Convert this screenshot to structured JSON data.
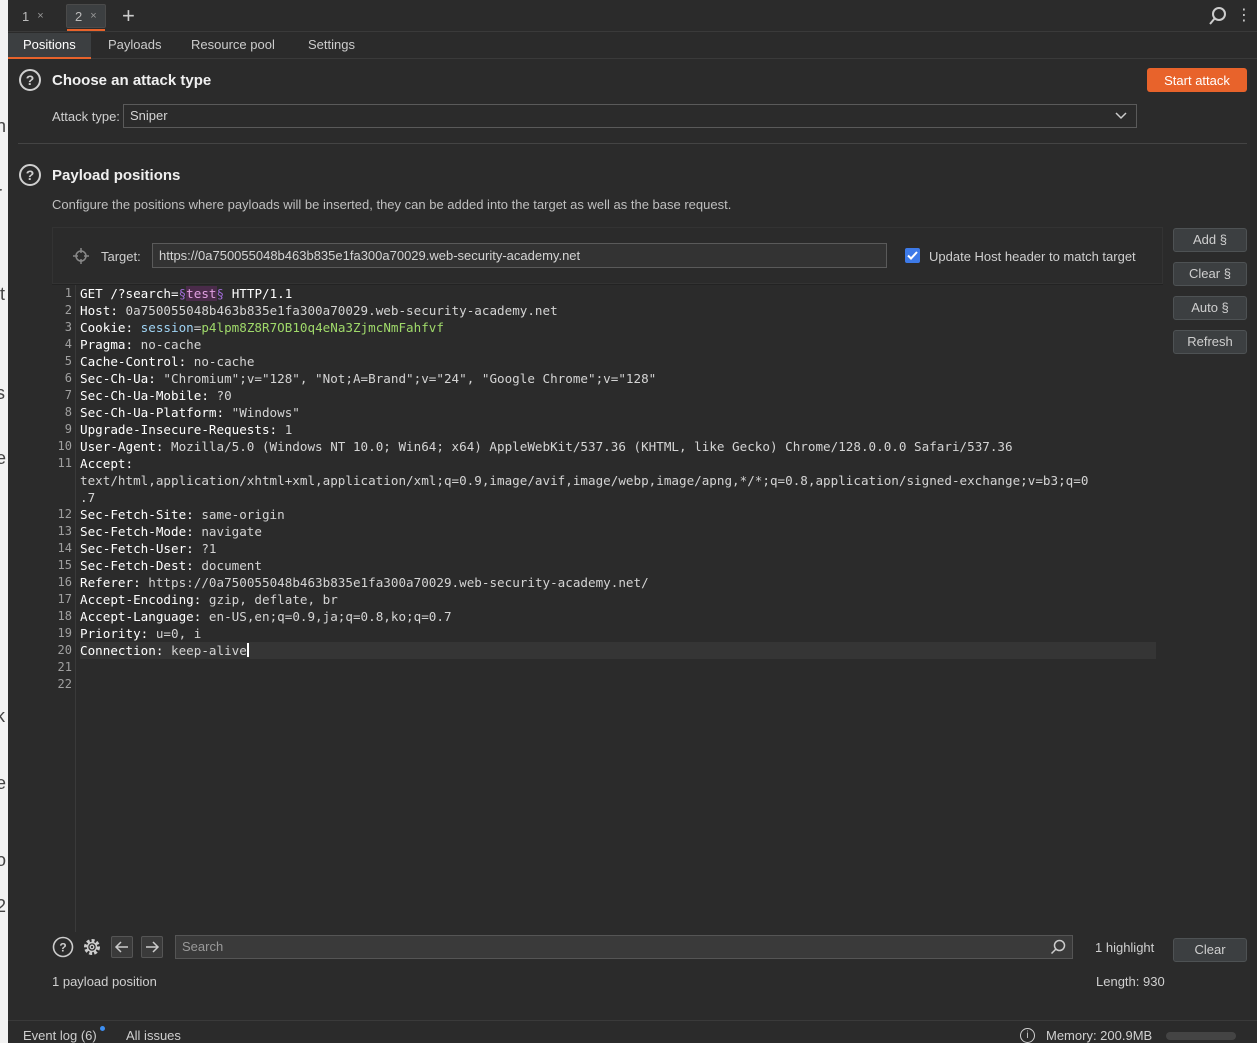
{
  "window_tabs": [
    {
      "label": "1",
      "close": "×"
    },
    {
      "label": "2",
      "close": "×"
    }
  ],
  "new_tab_label": "+",
  "sub_tabs": [
    "Positions",
    "Payloads",
    "Resource pool",
    "Settings"
  ],
  "active_sub_tab": "Positions",
  "attack_section": {
    "help": "?",
    "title": "Choose an attack type",
    "start_button": "Start attack",
    "attack_type_label": "Attack type:",
    "attack_type_value": "Sniper"
  },
  "positions_section": {
    "help": "?",
    "title": "Payload positions",
    "description": "Configure the positions where payloads will be inserted, they can be added into the target as well as the base request.",
    "target_label": "Target:",
    "target_value": "https://0a750055048b463b835e1fa300a70029.web-security-academy.net",
    "update_host_checked": true,
    "update_host_label": "Update Host header to match target"
  },
  "side_buttons": {
    "add": "Add §",
    "clear": "Clear §",
    "auto": "Auto §",
    "refresh": "Refresh"
  },
  "request": {
    "line1": {
      "prefix": "GET /?search=",
      "open": "§",
      "payload": "test",
      "close": "§",
      "suffix": " HTTP/1.1"
    },
    "headers": [
      {
        "n": "2",
        "k": "Host:",
        "v": " 0a750055048b463b835e1fa300a70029.web-security-academy.net"
      },
      {
        "n": "4",
        "k": "Pragma:",
        "v": " no-cache"
      },
      {
        "n": "5",
        "k": "Cache-Control:",
        "v": " no-cache"
      },
      {
        "n": "6",
        "k": "Sec-Ch-Ua:",
        "v": " \"Chromium\";v=\"128\", \"Not;A=Brand\";v=\"24\", \"Google Chrome\";v=\"128\""
      },
      {
        "n": "7",
        "k": "Sec-Ch-Ua-Mobile:",
        "v": " ?0"
      },
      {
        "n": "8",
        "k": "Sec-Ch-Ua-Platform:",
        "v": " \"Windows\""
      },
      {
        "n": "9",
        "k": "Upgrade-Insecure-Requests:",
        "v": " 1"
      },
      {
        "n": "10",
        "k": "User-Agent:",
        "v": " Mozilla/5.0 (Windows NT 10.0; Win64; x64) AppleWebKit/537.36 (KHTML, like Gecko) Chrome/128.0.0.0 Safari/537.36"
      },
      {
        "n": "11",
        "k": "Accept:",
        "v": ""
      },
      {
        "n": "12",
        "k": "Sec-Fetch-Site:",
        "v": " same-origin"
      },
      {
        "n": "13",
        "k": "Sec-Fetch-Mode:",
        "v": " navigate"
      },
      {
        "n": "14",
        "k": "Sec-Fetch-User:",
        "v": " ?1"
      },
      {
        "n": "15",
        "k": "Sec-Fetch-Dest:",
        "v": " document"
      },
      {
        "n": "16",
        "k": "Referer:",
        "v": " https://0a750055048b463b835e1fa300a70029.web-security-academy.net/"
      },
      {
        "n": "17",
        "k": "Accept-Encoding:",
        "v": " gzip, deflate, br"
      },
      {
        "n": "18",
        "k": "Accept-Language:",
        "v": " en-US,en;q=0.9,ja;q=0.8,ko;q=0.7"
      },
      {
        "n": "19",
        "k": "Priority:",
        "v": " u=0, i"
      },
      {
        "n": "20",
        "k": "Connection:",
        "v": " keep-alive"
      }
    ],
    "cookie": {
      "n": "3",
      "k": "Cookie:",
      "name": " session",
      "eq": "=",
      "value": "p4lpm8Z8R7OB10q4eNa3ZjmcNmFahfvf"
    },
    "accept_wrap1": "text/html,application/xhtml+xml,application/xml;q=0.9,image/avif,image/webp,image/apng,*/*;q=0.8,application/signed-exchange;v=b3;q=0",
    "accept_wrap2": ".7",
    "line_numbers": [
      "1",
      "2",
      "3",
      "4",
      "5",
      "6",
      "7",
      "8",
      "9",
      "10",
      "11",
      "12",
      "13",
      "14",
      "15",
      "16",
      "17",
      "18",
      "19",
      "20",
      "21",
      "22"
    ]
  },
  "search": {
    "placeholder": "Search",
    "highlight_count": "1 highlight",
    "clear_button": "Clear"
  },
  "footer": {
    "payload_positions": "1 payload position",
    "length": "Length: 930"
  },
  "statusbar": {
    "event_log": "Event log (6)",
    "all_issues": "All issues",
    "memory": "Memory: 200.9MB",
    "memory_fraction": 0.0
  },
  "colors": {
    "accent": "#e8632b",
    "checkbox": "#3d7ae8",
    "payload_marker": "#a06ad6"
  }
}
